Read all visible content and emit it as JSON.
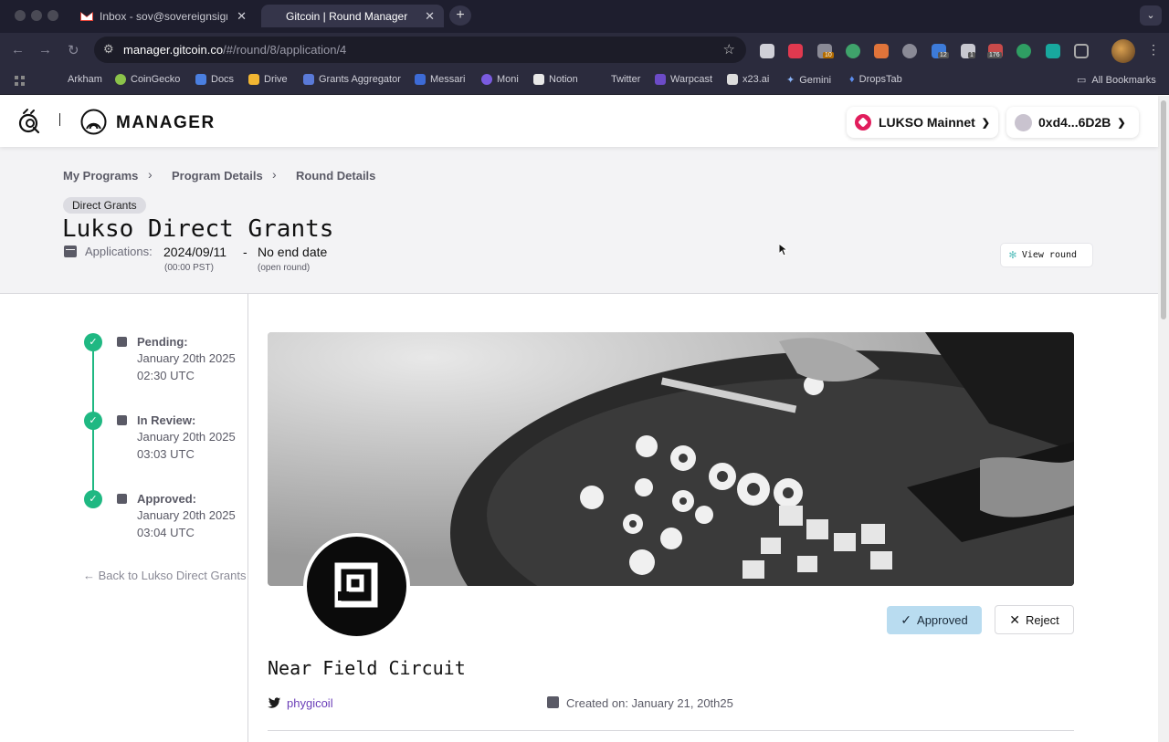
{
  "browser": {
    "tabs": [
      {
        "title": "Inbox - sov@sovereignsignal",
        "active": false
      },
      {
        "title": "Gitcoin | Round Manager",
        "active": true
      }
    ],
    "url_host": "manager.gitcoin.co",
    "url_path": "/#/round/8/application/4",
    "bookmarks": [
      "Arkham",
      "CoinGecko",
      "Docs",
      "Drive",
      "Grants Aggregator",
      "Messari",
      "Moni",
      "Notion",
      "Twitter",
      "Warpcast",
      "x23.ai",
      "Gemini",
      "DropsTab"
    ],
    "all_bookmarks": "All Bookmarks",
    "extension_badges": [
      "10",
      "12",
      "1",
      "176"
    ]
  },
  "header": {
    "brand": "MANAGER",
    "network": "LUKSO Mainnet",
    "wallet": "0xd4...6D2B"
  },
  "round": {
    "breadcrumbs": [
      "My Programs",
      "Program Details",
      "Round Details"
    ],
    "badge": "Direct Grants",
    "title": "Lukso Direct Grants",
    "applications_label": "Applications:",
    "start_date": "2024/09/11",
    "start_tz": "(00:00 PST)",
    "dash": "-",
    "end_date": "No end date",
    "end_note": "(open round)",
    "view_round": "View round"
  },
  "timeline": [
    {
      "label": "Pending:",
      "date": "January 20th 2025",
      "time": "02:30 UTC"
    },
    {
      "label": "In Review:",
      "date": "January 20th 2025",
      "time": "03:03 UTC"
    },
    {
      "label": "Approved:",
      "date": "January 20th 2025",
      "time": "03:04 UTC"
    }
  ],
  "back_link": "Back to Lukso Direct Grants",
  "application": {
    "project_name": "Near Field Circuit",
    "twitter": "phygicoil",
    "created_on": "Created on: January 21, 20th25",
    "approved_label": "Approved",
    "reject_label": "Reject"
  },
  "colors": {
    "accent_green": "#1fb882",
    "approved_bg": "#b9dcf0",
    "lukso_pink": "#e11d5c",
    "twitter_link": "#6b3fb8"
  }
}
